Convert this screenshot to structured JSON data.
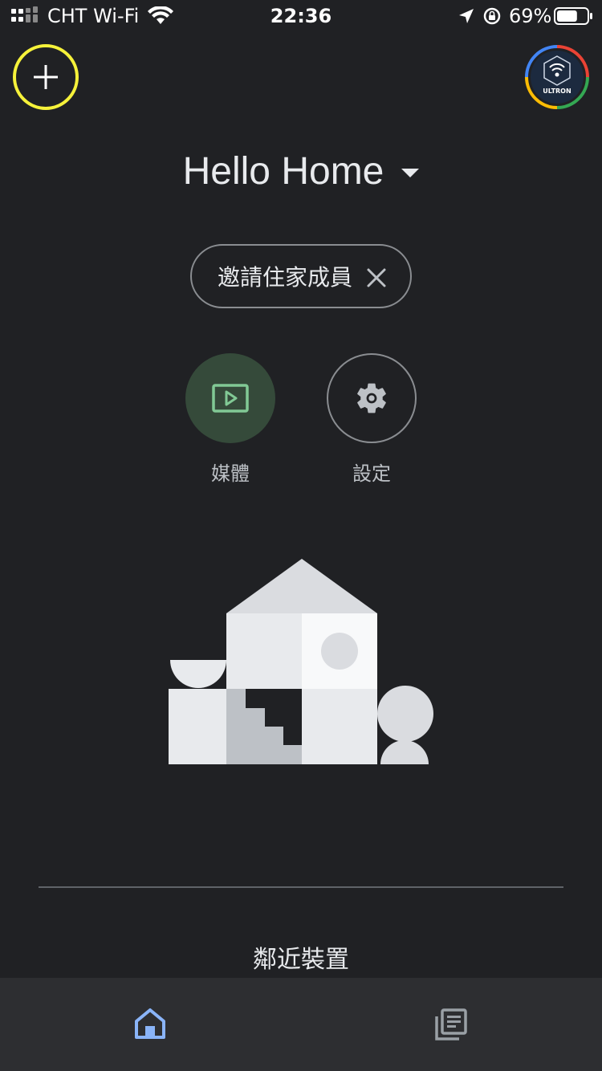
{
  "status_bar": {
    "carrier": "CHT Wi-Fi",
    "time": "22:36",
    "battery_percent": "69%",
    "battery_level": 0.69
  },
  "header": {
    "home_name": "Hello Home",
    "avatar_text": "ULTRON"
  },
  "invite_chip": {
    "label": "邀請住家成員"
  },
  "actions": {
    "media_label": "媒體",
    "settings_label": "設定"
  },
  "section": {
    "title": "鄰近裝置"
  },
  "colors": {
    "background": "#202124",
    "accent_yellow": "#f6f23a",
    "media_circle": "#354a3a",
    "media_icon": "#81c995",
    "nav_active": "#8ab4f8",
    "nav_bar": "#2d2e31"
  },
  "icons": {
    "add": "plus-icon",
    "dropdown": "caret-down-icon",
    "close": "close-icon",
    "media": "tv-play-icon",
    "settings": "gear-icon",
    "home": "home-icon",
    "feed": "feed-icon"
  }
}
